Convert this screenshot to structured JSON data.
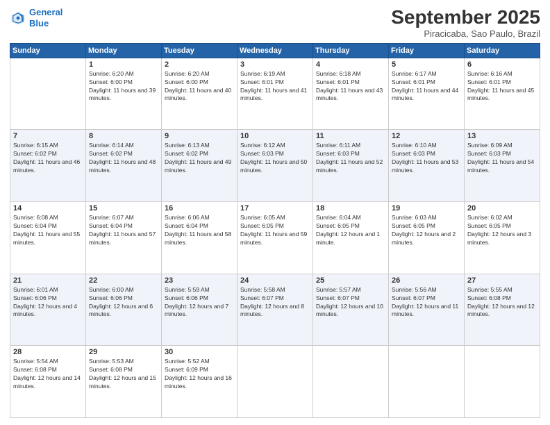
{
  "header": {
    "logo_line1": "General",
    "logo_line2": "Blue",
    "month": "September 2025",
    "location": "Piracicaba, Sao Paulo, Brazil"
  },
  "weekdays": [
    "Sunday",
    "Monday",
    "Tuesday",
    "Wednesday",
    "Thursday",
    "Friday",
    "Saturday"
  ],
  "weeks": [
    [
      {
        "day": "",
        "empty": true
      },
      {
        "day": "1",
        "sunrise": "6:20 AM",
        "sunset": "6:00 PM",
        "daylight": "11 hours and 39 minutes."
      },
      {
        "day": "2",
        "sunrise": "6:20 AM",
        "sunset": "6:00 PM",
        "daylight": "11 hours and 40 minutes."
      },
      {
        "day": "3",
        "sunrise": "6:19 AM",
        "sunset": "6:01 PM",
        "daylight": "11 hours and 41 minutes."
      },
      {
        "day": "4",
        "sunrise": "6:18 AM",
        "sunset": "6:01 PM",
        "daylight": "11 hours and 43 minutes."
      },
      {
        "day": "5",
        "sunrise": "6:17 AM",
        "sunset": "6:01 PM",
        "daylight": "11 hours and 44 minutes."
      },
      {
        "day": "6",
        "sunrise": "6:16 AM",
        "sunset": "6:01 PM",
        "daylight": "11 hours and 45 minutes."
      }
    ],
    [
      {
        "day": "7",
        "sunrise": "6:15 AM",
        "sunset": "6:02 PM",
        "daylight": "11 hours and 46 minutes."
      },
      {
        "day": "8",
        "sunrise": "6:14 AM",
        "sunset": "6:02 PM",
        "daylight": "11 hours and 48 minutes."
      },
      {
        "day": "9",
        "sunrise": "6:13 AM",
        "sunset": "6:02 PM",
        "daylight": "11 hours and 49 minutes."
      },
      {
        "day": "10",
        "sunrise": "6:12 AM",
        "sunset": "6:03 PM",
        "daylight": "11 hours and 50 minutes."
      },
      {
        "day": "11",
        "sunrise": "6:11 AM",
        "sunset": "6:03 PM",
        "daylight": "11 hours and 52 minutes."
      },
      {
        "day": "12",
        "sunrise": "6:10 AM",
        "sunset": "6:03 PM",
        "daylight": "11 hours and 53 minutes."
      },
      {
        "day": "13",
        "sunrise": "6:09 AM",
        "sunset": "6:03 PM",
        "daylight": "11 hours and 54 minutes."
      }
    ],
    [
      {
        "day": "14",
        "sunrise": "6:08 AM",
        "sunset": "6:04 PM",
        "daylight": "11 hours and 55 minutes."
      },
      {
        "day": "15",
        "sunrise": "6:07 AM",
        "sunset": "6:04 PM",
        "daylight": "11 hours and 57 minutes."
      },
      {
        "day": "16",
        "sunrise": "6:06 AM",
        "sunset": "6:04 PM",
        "daylight": "11 hours and 58 minutes."
      },
      {
        "day": "17",
        "sunrise": "6:05 AM",
        "sunset": "6:05 PM",
        "daylight": "11 hours and 59 minutes."
      },
      {
        "day": "18",
        "sunrise": "6:04 AM",
        "sunset": "6:05 PM",
        "daylight": "12 hours and 1 minute."
      },
      {
        "day": "19",
        "sunrise": "6:03 AM",
        "sunset": "6:05 PM",
        "daylight": "12 hours and 2 minutes."
      },
      {
        "day": "20",
        "sunrise": "6:02 AM",
        "sunset": "6:05 PM",
        "daylight": "12 hours and 3 minutes."
      }
    ],
    [
      {
        "day": "21",
        "sunrise": "6:01 AM",
        "sunset": "6:06 PM",
        "daylight": "12 hours and 4 minutes."
      },
      {
        "day": "22",
        "sunrise": "6:00 AM",
        "sunset": "6:06 PM",
        "daylight": "12 hours and 6 minutes."
      },
      {
        "day": "23",
        "sunrise": "5:59 AM",
        "sunset": "6:06 PM",
        "daylight": "12 hours and 7 minutes."
      },
      {
        "day": "24",
        "sunrise": "5:58 AM",
        "sunset": "6:07 PM",
        "daylight": "12 hours and 8 minutes."
      },
      {
        "day": "25",
        "sunrise": "5:57 AM",
        "sunset": "6:07 PM",
        "daylight": "12 hours and 10 minutes."
      },
      {
        "day": "26",
        "sunrise": "5:56 AM",
        "sunset": "6:07 PM",
        "daylight": "12 hours and 11 minutes."
      },
      {
        "day": "27",
        "sunrise": "5:55 AM",
        "sunset": "6:08 PM",
        "daylight": "12 hours and 12 minutes."
      }
    ],
    [
      {
        "day": "28",
        "sunrise": "5:54 AM",
        "sunset": "6:08 PM",
        "daylight": "12 hours and 14 minutes."
      },
      {
        "day": "29",
        "sunrise": "5:53 AM",
        "sunset": "6:08 PM",
        "daylight": "12 hours and 15 minutes."
      },
      {
        "day": "30",
        "sunrise": "5:52 AM",
        "sunset": "6:09 PM",
        "daylight": "12 hours and 16 minutes."
      },
      {
        "day": "",
        "empty": true
      },
      {
        "day": "",
        "empty": true
      },
      {
        "day": "",
        "empty": true
      },
      {
        "day": "",
        "empty": true
      }
    ]
  ]
}
